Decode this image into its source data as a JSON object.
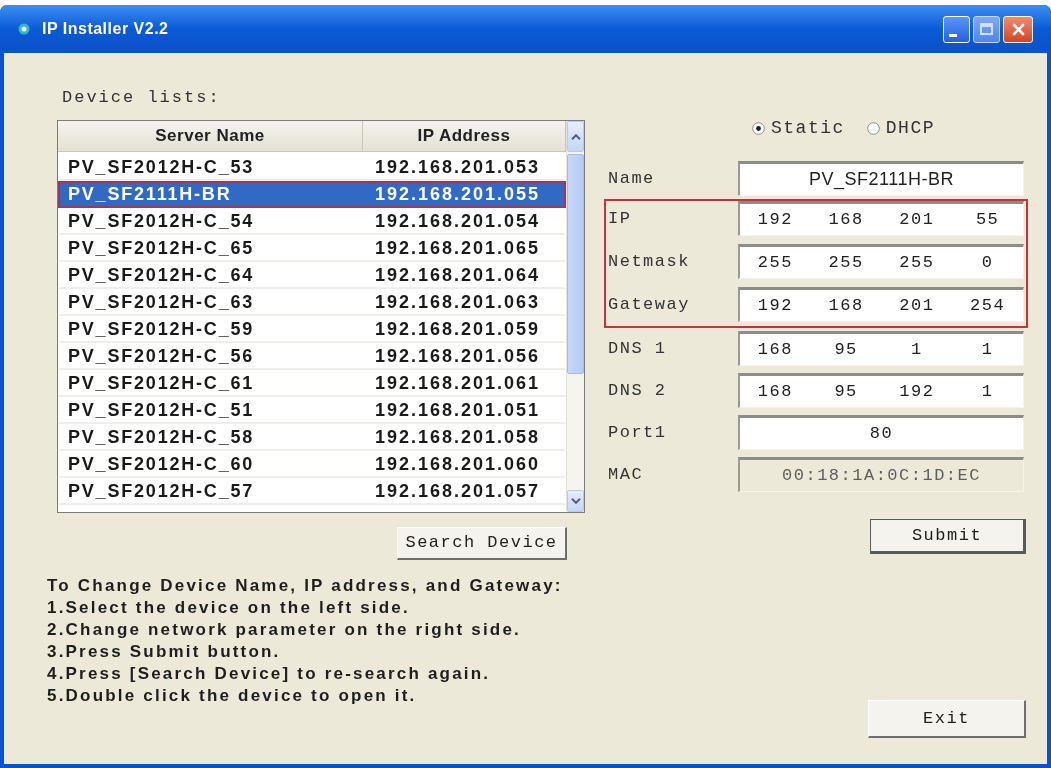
{
  "window": {
    "title": "IP Installer V2.2"
  },
  "device_list": {
    "label": "Device lists:",
    "columns": [
      "Server Name",
      "IP Address"
    ],
    "rows": [
      {
        "server_name": "PV_SF2012H-C_53",
        "ip_address": "192.168.201.053",
        "selected": false,
        "highlighted": false
      },
      {
        "server_name": "PV_SF2111H-BR",
        "ip_address": "192.168.201.055",
        "selected": true,
        "highlighted": true
      },
      {
        "server_name": "PV_SF2012H-C_54",
        "ip_address": "192.168.201.054",
        "selected": false,
        "highlighted": false
      },
      {
        "server_name": "PV_SF2012H-C_65",
        "ip_address": "192.168.201.065",
        "selected": false,
        "highlighted": false
      },
      {
        "server_name": "PV_SF2012H-C_64",
        "ip_address": "192.168.201.064",
        "selected": false,
        "highlighted": false
      },
      {
        "server_name": "PV_SF2012H-C_63",
        "ip_address": "192.168.201.063",
        "selected": false,
        "highlighted": false
      },
      {
        "server_name": "PV_SF2012H-C_59",
        "ip_address": "192.168.201.059",
        "selected": false,
        "highlighted": false
      },
      {
        "server_name": "PV_SF2012H-C_56",
        "ip_address": "192.168.201.056",
        "selected": false,
        "highlighted": false
      },
      {
        "server_name": "PV_SF2012H-C_61",
        "ip_address": "192.168.201.061",
        "selected": false,
        "highlighted": false
      },
      {
        "server_name": "PV_SF2012H-C_51",
        "ip_address": "192.168.201.051",
        "selected": false,
        "highlighted": false
      },
      {
        "server_name": "PV_SF2012H-C_58",
        "ip_address": "192.168.201.058",
        "selected": false,
        "highlighted": false
      },
      {
        "server_name": "PV_SF2012H-C_60",
        "ip_address": "192.168.201.060",
        "selected": false,
        "highlighted": false
      },
      {
        "server_name": "PV_SF2012H-C_57",
        "ip_address": "192.168.201.057",
        "selected": false,
        "highlighted": false
      }
    ]
  },
  "search_button": "Search Device",
  "instructions": [
    "To Change Device Name, IP address, and Gateway:",
    "1.Select the device on the left side.",
    "2.Change network parameter on the right side.",
    "3.Press Submit button.",
    "4.Press [Search Device] to re-search again.",
    "5.Double click the device to open it."
  ],
  "mode": [
    {
      "label": "Static",
      "selected": true
    },
    {
      "label": "DHCP",
      "selected": false
    }
  ],
  "fields": [
    {
      "label": "Name",
      "kind": "text",
      "value": "PV_SF2111H-BR",
      "disabled": false,
      "highlighted": false
    },
    {
      "label": "IP",
      "kind": "octets",
      "parts": [
        "192",
        "168",
        "201",
        "55"
      ],
      "disabled": false,
      "highlighted": true
    },
    {
      "label": "Netmask",
      "kind": "octets",
      "parts": [
        "255",
        "255",
        "255",
        "0"
      ],
      "disabled": false,
      "highlighted": true
    },
    {
      "label": "Gateway",
      "kind": "octets",
      "parts": [
        "192",
        "168",
        "201",
        "254"
      ],
      "disabled": false,
      "highlighted": true
    },
    {
      "label": "DNS 1",
      "kind": "octets",
      "parts": [
        "168",
        "95",
        "1",
        "1"
      ],
      "disabled": false,
      "highlighted": false
    },
    {
      "label": "DNS 2",
      "kind": "octets",
      "parts": [
        "168",
        "95",
        "192",
        "1"
      ],
      "disabled": false,
      "highlighted": false
    },
    {
      "label": "Port1",
      "kind": "text",
      "value": "80",
      "disabled": false,
      "highlighted": false
    },
    {
      "label": "MAC",
      "kind": "text",
      "value": "00:18:1A:0C:1D:EC",
      "disabled": true,
      "highlighted": false
    }
  ],
  "submit_button": "Submit",
  "exit_button": "Exit"
}
